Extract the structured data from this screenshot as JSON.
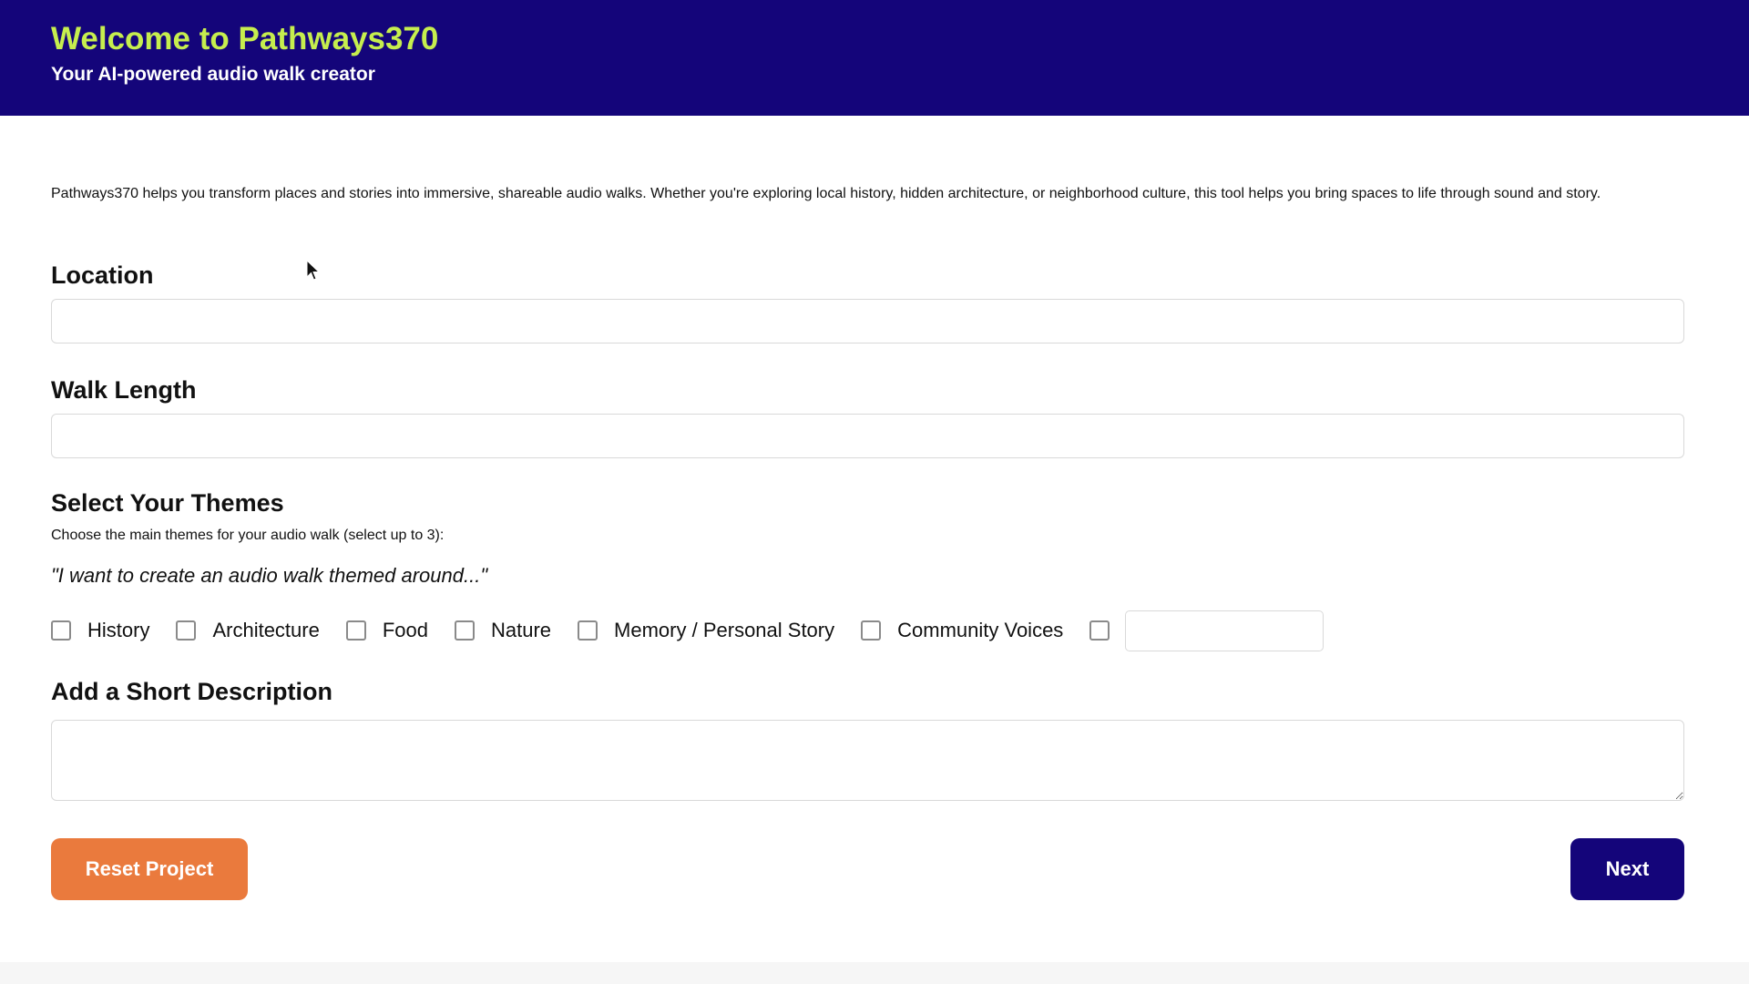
{
  "header": {
    "title": "Welcome to Pathways370",
    "subtitle": "Your AI-powered audio walk creator"
  },
  "intro": "Pathways370 helps you transform places and stories into immersive, shareable audio walks. Whether you're exploring local history, hidden architecture, or neighborhood culture, this tool helps you bring spaces to life through sound and story.",
  "location": {
    "label": "Location",
    "value": "",
    "placeholder": ""
  },
  "walk_length": {
    "label": "Walk Length",
    "value": "",
    "placeholder": ""
  },
  "themes": {
    "heading": "Select Your Themes",
    "help": "Choose the main themes for your audio walk (select up to 3):",
    "prompt": "\"I want to create an audio walk themed around...\"",
    "options": [
      {
        "label": "History",
        "checked": false
      },
      {
        "label": "Architecture",
        "checked": false
      },
      {
        "label": "Food",
        "checked": false
      },
      {
        "label": "Nature",
        "checked": false
      },
      {
        "label": "Memory / Personal Story",
        "checked": false
      },
      {
        "label": "Community Voices",
        "checked": false
      }
    ],
    "other": {
      "checked": false,
      "value": "",
      "placeholder": ""
    }
  },
  "description": {
    "heading": "Add a Short Description",
    "value": "",
    "placeholder": ""
  },
  "buttons": {
    "reset": "Reset Project",
    "next": "Next"
  },
  "colors": {
    "header_bg": "#14057a",
    "title_accent": "#c6ee4e",
    "reset_button": "#ea7a3d",
    "next_button": "#14057a"
  }
}
